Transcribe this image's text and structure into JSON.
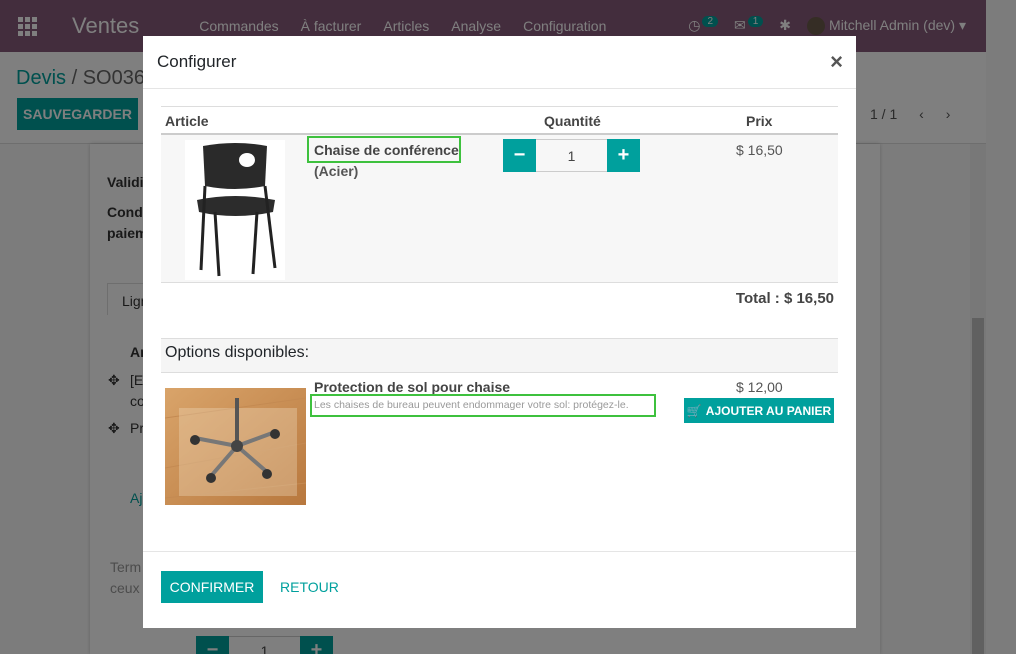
{
  "navbar": {
    "brand": "Ventes",
    "menu": [
      "Commandes",
      "À facturer",
      "Articles",
      "Analyse",
      "Configuration"
    ],
    "activity_count": "2",
    "message_count": "1",
    "user": "Mitchell Admin (dev)"
  },
  "page": {
    "breadcrumb_parent": "Devis",
    "breadcrumb_current": "SO036",
    "save_label": "SAUVEGARDER",
    "pager": "1 / 1",
    "bg_labels": {
      "validity": "Validi",
      "conditions_1": "Condi",
      "conditions_2": "paiem",
      "tab": "Lign",
      "col": "Ar",
      "row1a": "[E",
      "row1b": "co",
      "row2": "Pr",
      "add": "Aj",
      "terms1": "Term",
      "terms2": "ceux"
    }
  },
  "modal": {
    "title": "Configurer",
    "close": "×",
    "columns": {
      "article": "Article",
      "quantity": "Quantité",
      "price": "Prix"
    },
    "product": {
      "name": "Chaise de conférence",
      "variant": "(Acier)",
      "quantity": "1",
      "price": "$ 16,50"
    },
    "total": "Total : $ 16,50",
    "options_title": "Options disponibles:",
    "option": {
      "name": "Protection de sol pour chaise",
      "description": "Les chaises de bureau peuvent endommager votre sol: protégez-le.",
      "price": "$ 12,00",
      "add_label": "AJOUTER AU PANIER"
    },
    "confirm_label": "CONFIRMER",
    "back_label": "RETOUR"
  },
  "bottom": {
    "quantity": "1"
  },
  "colors": {
    "brand": "#875a7b",
    "accent": "#00a09d",
    "highlight": "#3ec13e"
  }
}
